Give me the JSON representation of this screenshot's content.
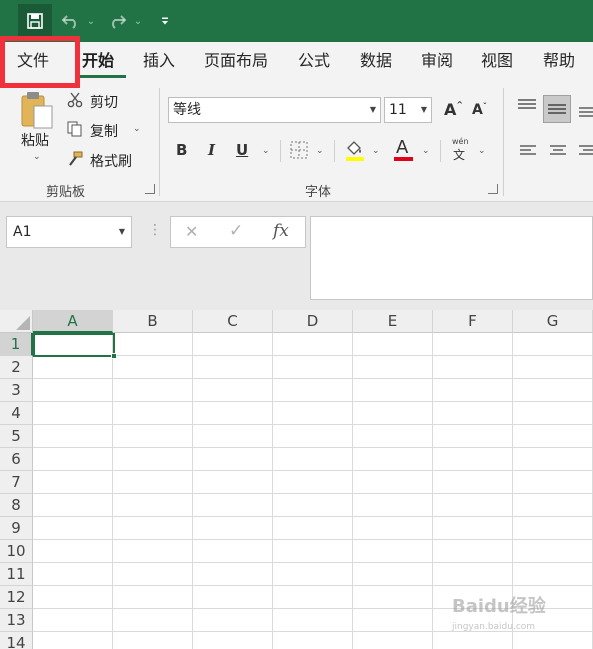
{
  "app": {
    "accent": "#217346",
    "highlight_color": "#f0303a"
  },
  "quick_access": {
    "save": "save-icon",
    "undo": "undo-icon",
    "redo": "redo-icon",
    "customize": "customize-icon"
  },
  "tabs": [
    {
      "label": "文件"
    },
    {
      "label": "开始"
    },
    {
      "label": "插入"
    },
    {
      "label": "页面布局"
    },
    {
      "label": "公式"
    },
    {
      "label": "数据"
    },
    {
      "label": "审阅"
    },
    {
      "label": "视图"
    },
    {
      "label": "帮助"
    }
  ],
  "ribbon": {
    "clipboard": {
      "paste": "粘贴",
      "cut": "剪切",
      "copy": "复制",
      "format_painter": "格式刷",
      "group": "剪贴板"
    },
    "font": {
      "font_name": "等线",
      "font_size": "11",
      "bold": "B",
      "italic": "I",
      "underline": "U",
      "font_color_letter": "A",
      "grow": "A",
      "shrink": "A",
      "phonetic_top": "wén",
      "phonetic_bottom": "文",
      "group": "字体"
    }
  },
  "formula_bar": {
    "name_box": "A1",
    "cancel": "✕",
    "enter": "✓",
    "fx": "fx",
    "value": ""
  },
  "grid": {
    "columns": [
      "A",
      "B",
      "C",
      "D",
      "E",
      "F",
      "G"
    ],
    "rows": [
      "1",
      "2",
      "3",
      "4",
      "5",
      "6",
      "7",
      "8",
      "9",
      "10",
      "11",
      "12",
      "13",
      "14"
    ],
    "active_cell": "A1"
  },
  "watermark": {
    "text": "Baidu经验",
    "url": "jingyan.baidu.com"
  }
}
